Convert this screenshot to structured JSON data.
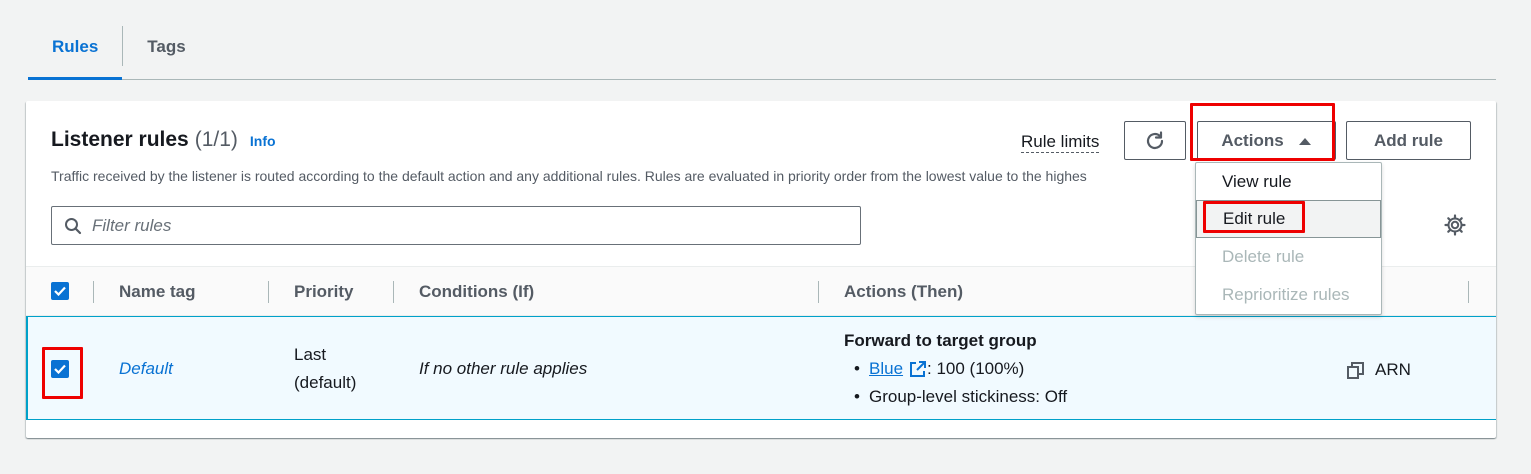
{
  "tabs": [
    {
      "label": "Rules",
      "active": true
    },
    {
      "label": "Tags",
      "active": false
    }
  ],
  "panel": {
    "title": "Listener rules",
    "count": "(1/1)",
    "info": "Info",
    "description": "Traffic received by the listener is routed according to the default action and any additional rules. Rules are evaluated in priority order from the lowest value to the highes",
    "rule_limits": "Rule limits",
    "actions_label": "Actions",
    "add_rule_label": "Add rule",
    "filter_placeholder": "Filter rules"
  },
  "table": {
    "columns": [
      "Name tag",
      "Priority",
      "Conditions (If)",
      "Actions (Then)"
    ],
    "rows": [
      {
        "selected": true,
        "name": "Default",
        "priority_line1": "Last",
        "priority_line2": "(default)",
        "conditions": "If no other rule applies",
        "action_title": "Forward to target group",
        "target_link": "Blue",
        "target_weight": ": 100 (100%)",
        "stickiness": "Group-level stickiness: Off",
        "arn_label": "ARN"
      }
    ]
  },
  "actions_menu": {
    "items": [
      {
        "label": "View rule",
        "disabled": false
      },
      {
        "label": "Edit rule",
        "disabled": false
      },
      {
        "label": "Delete rule",
        "disabled": true
      },
      {
        "label": "Reprioritize rules",
        "disabled": true
      }
    ]
  },
  "colors": {
    "accent": "#0972d3",
    "highlight_box": "#ee0000",
    "selected_row_bg": "#f1faff"
  }
}
